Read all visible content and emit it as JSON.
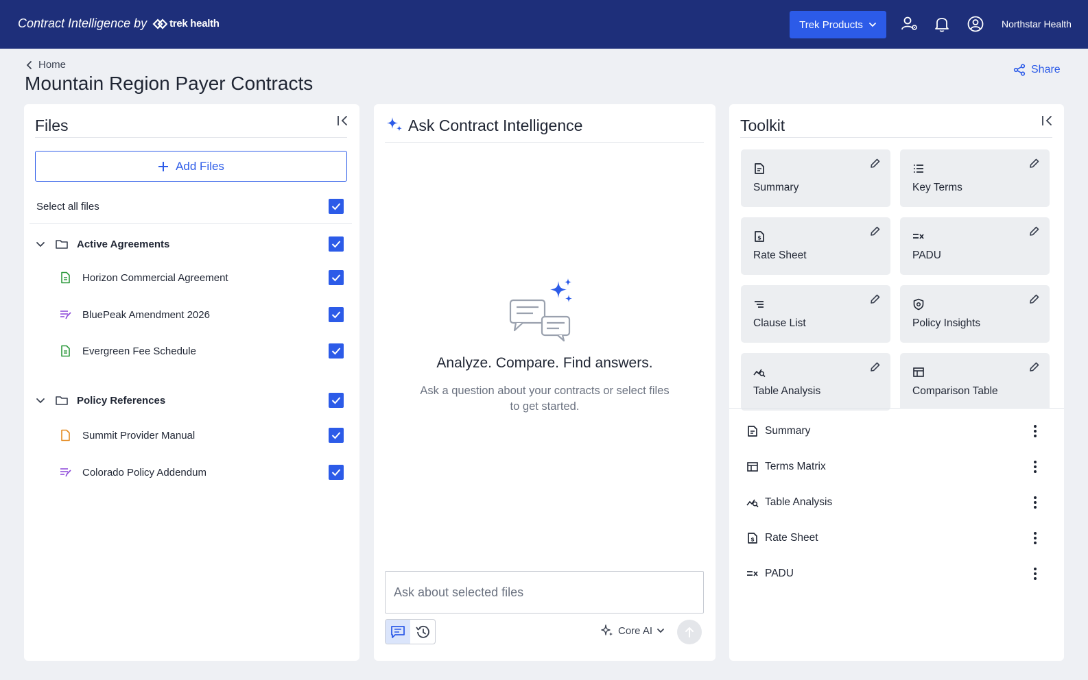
{
  "topbar": {
    "brand_text": "Contract Intelligence by",
    "logo_text": "trek health",
    "products_button": "Trek Products",
    "org_name": "Northstar Health",
    "icons": [
      "user-settings-icon",
      "bell-icon",
      "account-circle-icon"
    ]
  },
  "header": {
    "breadcrumb": "Home",
    "title": "Mountain Region Payer Contracts",
    "share_label": "Share"
  },
  "files": {
    "title": "Files",
    "add_files_label": "Add Files",
    "select_all_label": "Select all files",
    "select_all_checked": true,
    "folders": [
      {
        "name": "Active Agreements",
        "checked": true,
        "files": [
          {
            "name": "Horizon Commercial Agreement",
            "icon": "document-icon",
            "color": "#2e9a3e",
            "checked": true
          },
          {
            "name": "BluePeak Amendment 2026",
            "icon": "edited-text-icon",
            "color": "#8a44d8",
            "checked": true
          },
          {
            "name": "Evergreen Fee Schedule",
            "icon": "document-icon",
            "color": "#2e9a3e",
            "checked": true
          }
        ]
      },
      {
        "name": "Policy References",
        "checked": true,
        "files": [
          {
            "name": "Summit Provider Manual",
            "icon": "document-icon",
            "color": "#e58a1f",
            "checked": true
          },
          {
            "name": "Colorado Policy Addendum",
            "icon": "edited-text-icon",
            "color": "#8a44d8",
            "checked": true
          }
        ]
      }
    ]
  },
  "chat": {
    "title": "Ask Contract Intelligence",
    "empty_heading": "Analyze. Compare. Find answers.",
    "empty_sub": "Ask a question about your contracts or select files to get started.",
    "input_placeholder": "Ask about selected files",
    "model_label": "Core AI"
  },
  "toolkit": {
    "title": "Toolkit",
    "tiles": [
      {
        "label": "Summary",
        "icon": "summary-doc-icon"
      },
      {
        "label": "Key Terms",
        "icon": "list-icon"
      },
      {
        "label": "Rate Sheet",
        "icon": "rate-sheet-icon"
      },
      {
        "label": "PADU",
        "icon": "padu-icon"
      },
      {
        "label": "Clause List",
        "icon": "clause-list-icon"
      },
      {
        "label": "Policy Insights",
        "icon": "shield-icon"
      },
      {
        "label": "Table Analysis",
        "icon": "analysis-icon"
      },
      {
        "label": "Comparison Table",
        "icon": "table-icon"
      }
    ],
    "saved": [
      {
        "label": "Summary",
        "icon": "summary-doc-icon"
      },
      {
        "label": "Terms Matrix",
        "icon": "table-icon"
      },
      {
        "label": "Table Analysis",
        "icon": "analysis-icon"
      },
      {
        "label": "Rate Sheet",
        "icon": "rate-sheet-icon"
      },
      {
        "label": "PADU",
        "icon": "padu-icon"
      }
    ]
  },
  "colors": {
    "topbar": "#1e2f7a",
    "accent": "#2c5be8",
    "panel_bg": "#ffffff",
    "page_bg": "#eef0f4",
    "tile_bg": "#eceef1"
  }
}
